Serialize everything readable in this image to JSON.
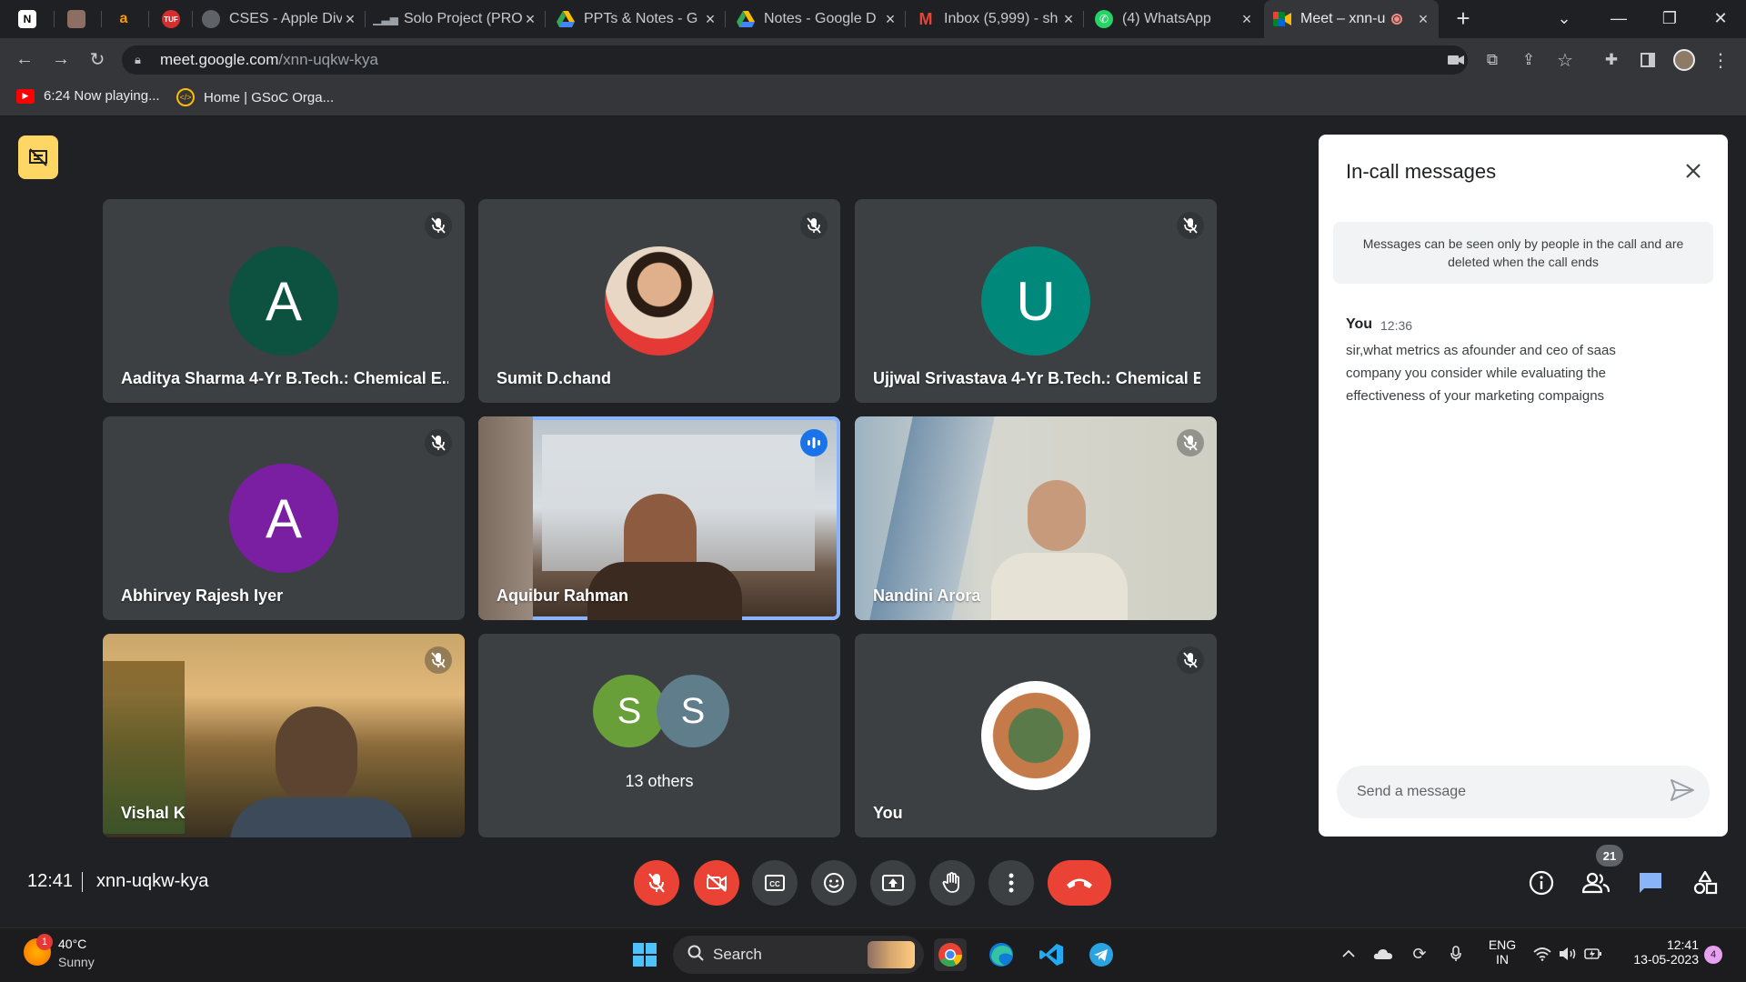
{
  "browser": {
    "tabs": [
      {
        "label": "",
        "icon": "notion-icon"
      },
      {
        "label": "",
        "icon": "profile-icon"
      },
      {
        "label": "",
        "icon": "amazon-icon"
      },
      {
        "label": "",
        "icon": "tuf-icon"
      },
      {
        "label": "CSES - Apple Divi",
        "icon": "globe-icon"
      },
      {
        "label": "Solo Project (PRO",
        "icon": "chart-icon"
      },
      {
        "label": "PPTs & Notes - G",
        "icon": "drive-icon"
      },
      {
        "label": "Notes - Google D",
        "icon": "drive-icon"
      },
      {
        "label": "Inbox (5,999) - sh",
        "icon": "gmail-icon"
      },
      {
        "label": "(4) WhatsApp",
        "icon": "whatsapp-icon"
      },
      {
        "label": "Meet – xnn-u",
        "icon": "meet-icon",
        "active": true
      }
    ],
    "url_host": "meet.google.com",
    "url_path": "/xnn-uqkw-kya",
    "bookmarks": [
      {
        "label": "6:24 Now playing...",
        "icon": "youtube-icon"
      },
      {
        "label": "Home | GSoC Orga...",
        "icon": "gsoc-icon"
      }
    ]
  },
  "meet": {
    "tiles": [
      {
        "name": "Aaditya Sharma 4-Yr B.Tech.: Chemical E...",
        "initial": "A",
        "avatar_color": "#0d5241",
        "muted": true
      },
      {
        "name": "Sumit D.chand",
        "initial": "",
        "photo": true,
        "muted": true
      },
      {
        "name": "Ujjwal Srivastava 4-Yr B.Tech.: Chemical E...",
        "initial": "U",
        "avatar_color": "#00897b",
        "muted": true
      },
      {
        "name": "Abhirvey Rajesh Iyer",
        "initial": "A",
        "avatar_color": "#7b1fa2",
        "muted": true
      },
      {
        "name": "Aquibur Rahman",
        "video": true,
        "speaking": true
      },
      {
        "name": "Nandini Arora",
        "video": true,
        "muted": true
      },
      {
        "name": "Vishal K",
        "video": true,
        "muted": true
      },
      {
        "name": "13 others",
        "initials": [
          "S",
          "S"
        ],
        "initial_colors": [
          "#689f38",
          "#607d8b"
        ]
      },
      {
        "name": "You",
        "photo": true,
        "muted": true
      }
    ],
    "clock": "12:41",
    "meeting_code": "xnn-uqkw-kya",
    "participant_count": "21"
  },
  "panel": {
    "title": "In-call messages",
    "notice": "Messages can be seen only by people in the call and are deleted when the call ends",
    "messages": [
      {
        "sender": "You",
        "time": "12:36",
        "text": "sir,what metrics as afounder and ceo of saas company you consider while evaluating the effectiveness of your marketing compaigns"
      }
    ],
    "input_placeholder": "Send a message"
  },
  "taskbar": {
    "weather_temp": "40°C",
    "weather_desc": "Sunny",
    "weather_badge": "1",
    "search_label": "Search",
    "lang_top": "ENG",
    "lang_bottom": "IN",
    "time": "12:41",
    "date": "13-05-2023",
    "notif_count": "4"
  },
  "colors": {
    "accent": "#8ab4f8",
    "hangup": "#ea4335",
    "present_badge": "#fdd663"
  }
}
